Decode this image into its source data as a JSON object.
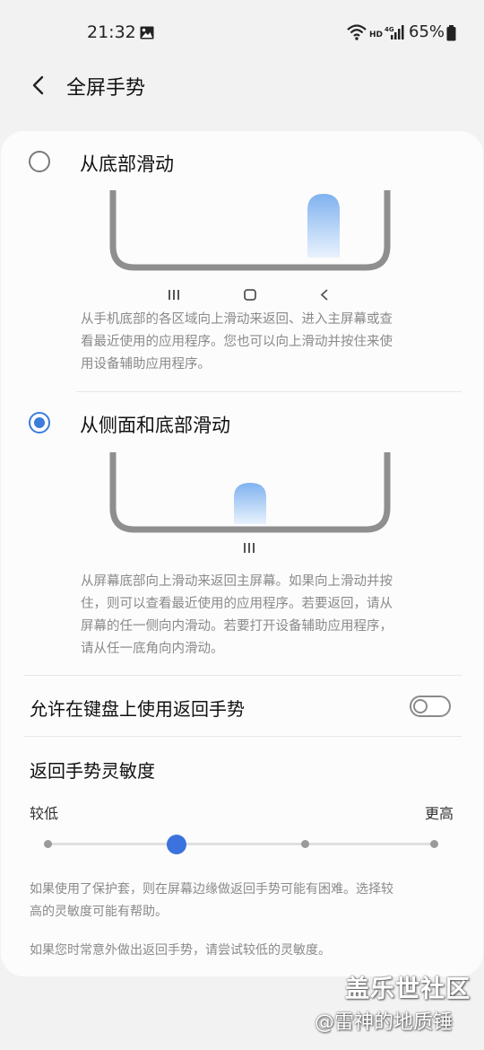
{
  "status_bar": {
    "time": "21:32",
    "battery": "65%",
    "icons": [
      "image-icon",
      "wifi-icon",
      "hd-4g-signal-icon",
      "battery-icon"
    ]
  },
  "header": {
    "title": "全屏手势"
  },
  "options": [
    {
      "label": "从底部滑动",
      "selected": false,
      "desc_lines": [
        "从手机底部的各区域向上滑动来返回、进入主屏幕或查",
        "看最近使用的应用程序。您也可以向上滑动并按住来使",
        "用设备辅助应用程序。"
      ]
    },
    {
      "label": "从侧面和底部滑动",
      "selected": true,
      "desc_lines": [
        "从屏幕底部向上滑动来返回主屏幕。如果向上滑动并按",
        "住，则可以查看最近使用的应用程序。若要返回，请从",
        "屏幕的任一侧向内滑动。若要打开设备辅助应用程序，",
        "请从任一底角向内滑动。"
      ]
    }
  ],
  "keyboard_setting": {
    "label": "允许在键盘上使用返回手势",
    "enabled": false
  },
  "sensitivity": {
    "title": "返回手势灵敏度",
    "low_label": "较低",
    "high_label": "更高",
    "steps": 4,
    "selected_step": 2,
    "notes": [
      [
        "如果使用了保护套，则在屏幕边缘做返回手势可能有困难。选择较",
        "高的灵敏度可能有帮助。"
      ],
      [
        "如果您时常意外做出返回手势，请尝试较低的灵敏度。"
      ]
    ]
  },
  "watermark": {
    "line1": "盖乐世社区",
    "line2": "@雷神的地质锤"
  },
  "colors": {
    "accent": "#3b7ddb",
    "background": "#f2f2f2",
    "card": "#fcfcfc"
  }
}
